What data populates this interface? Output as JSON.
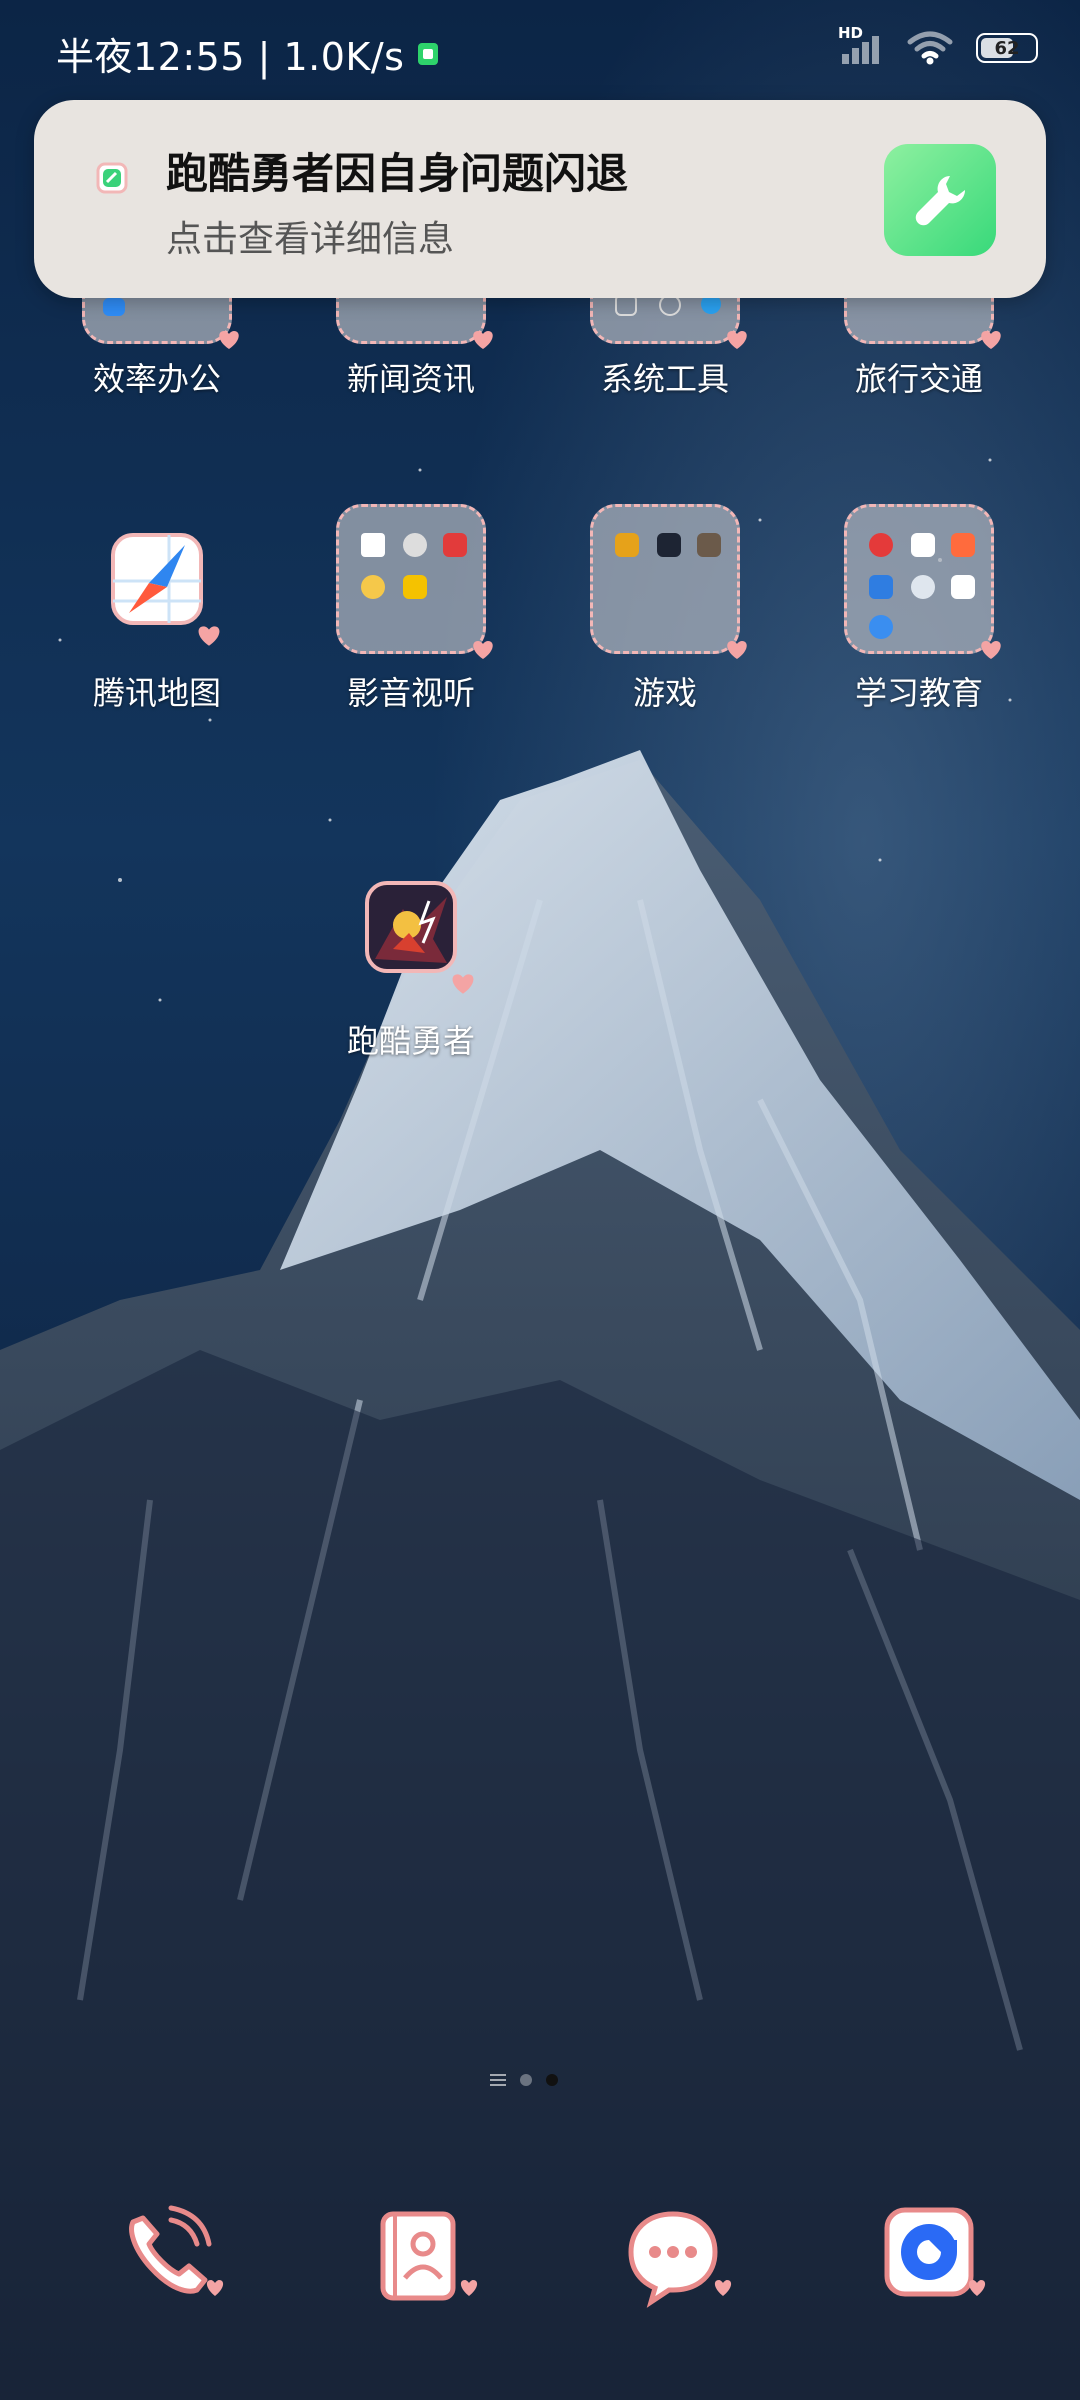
{
  "status_bar": {
    "time_speed": "半夜12:55 | 1.0K/s",
    "network_type": "HD",
    "battery_level": "62",
    "battery_fraction": 0.62
  },
  "notification": {
    "title": "跑酷勇者因自身问题闪退",
    "subtitle": "点击查看详细信息",
    "icon": "wrench-icon"
  },
  "home": {
    "row1": [
      {
        "label": "效率办公"
      },
      {
        "label": "新闻资讯"
      },
      {
        "label": "系统工具"
      },
      {
        "label": "旅行交通"
      }
    ],
    "row2": [
      {
        "label": "腾讯地图",
        "icon": "map-icon"
      },
      {
        "label": "影音视听"
      },
      {
        "label": "游戏"
      },
      {
        "label": "学习教育"
      }
    ],
    "row3": [
      {
        "label": "跑酷勇者",
        "icon": "game-icon"
      }
    ]
  },
  "dock": [
    {
      "name": "phone",
      "icon": "phone-icon"
    },
    {
      "name": "contacts",
      "icon": "contacts-icon"
    },
    {
      "name": "messages",
      "icon": "messages-icon"
    },
    {
      "name": "browser",
      "icon": "browser-icon"
    }
  ],
  "colors": {
    "notification_bg": "#e8e4e0",
    "accent_green": "#38d97a",
    "icon_outline": "#f2b7b7"
  }
}
